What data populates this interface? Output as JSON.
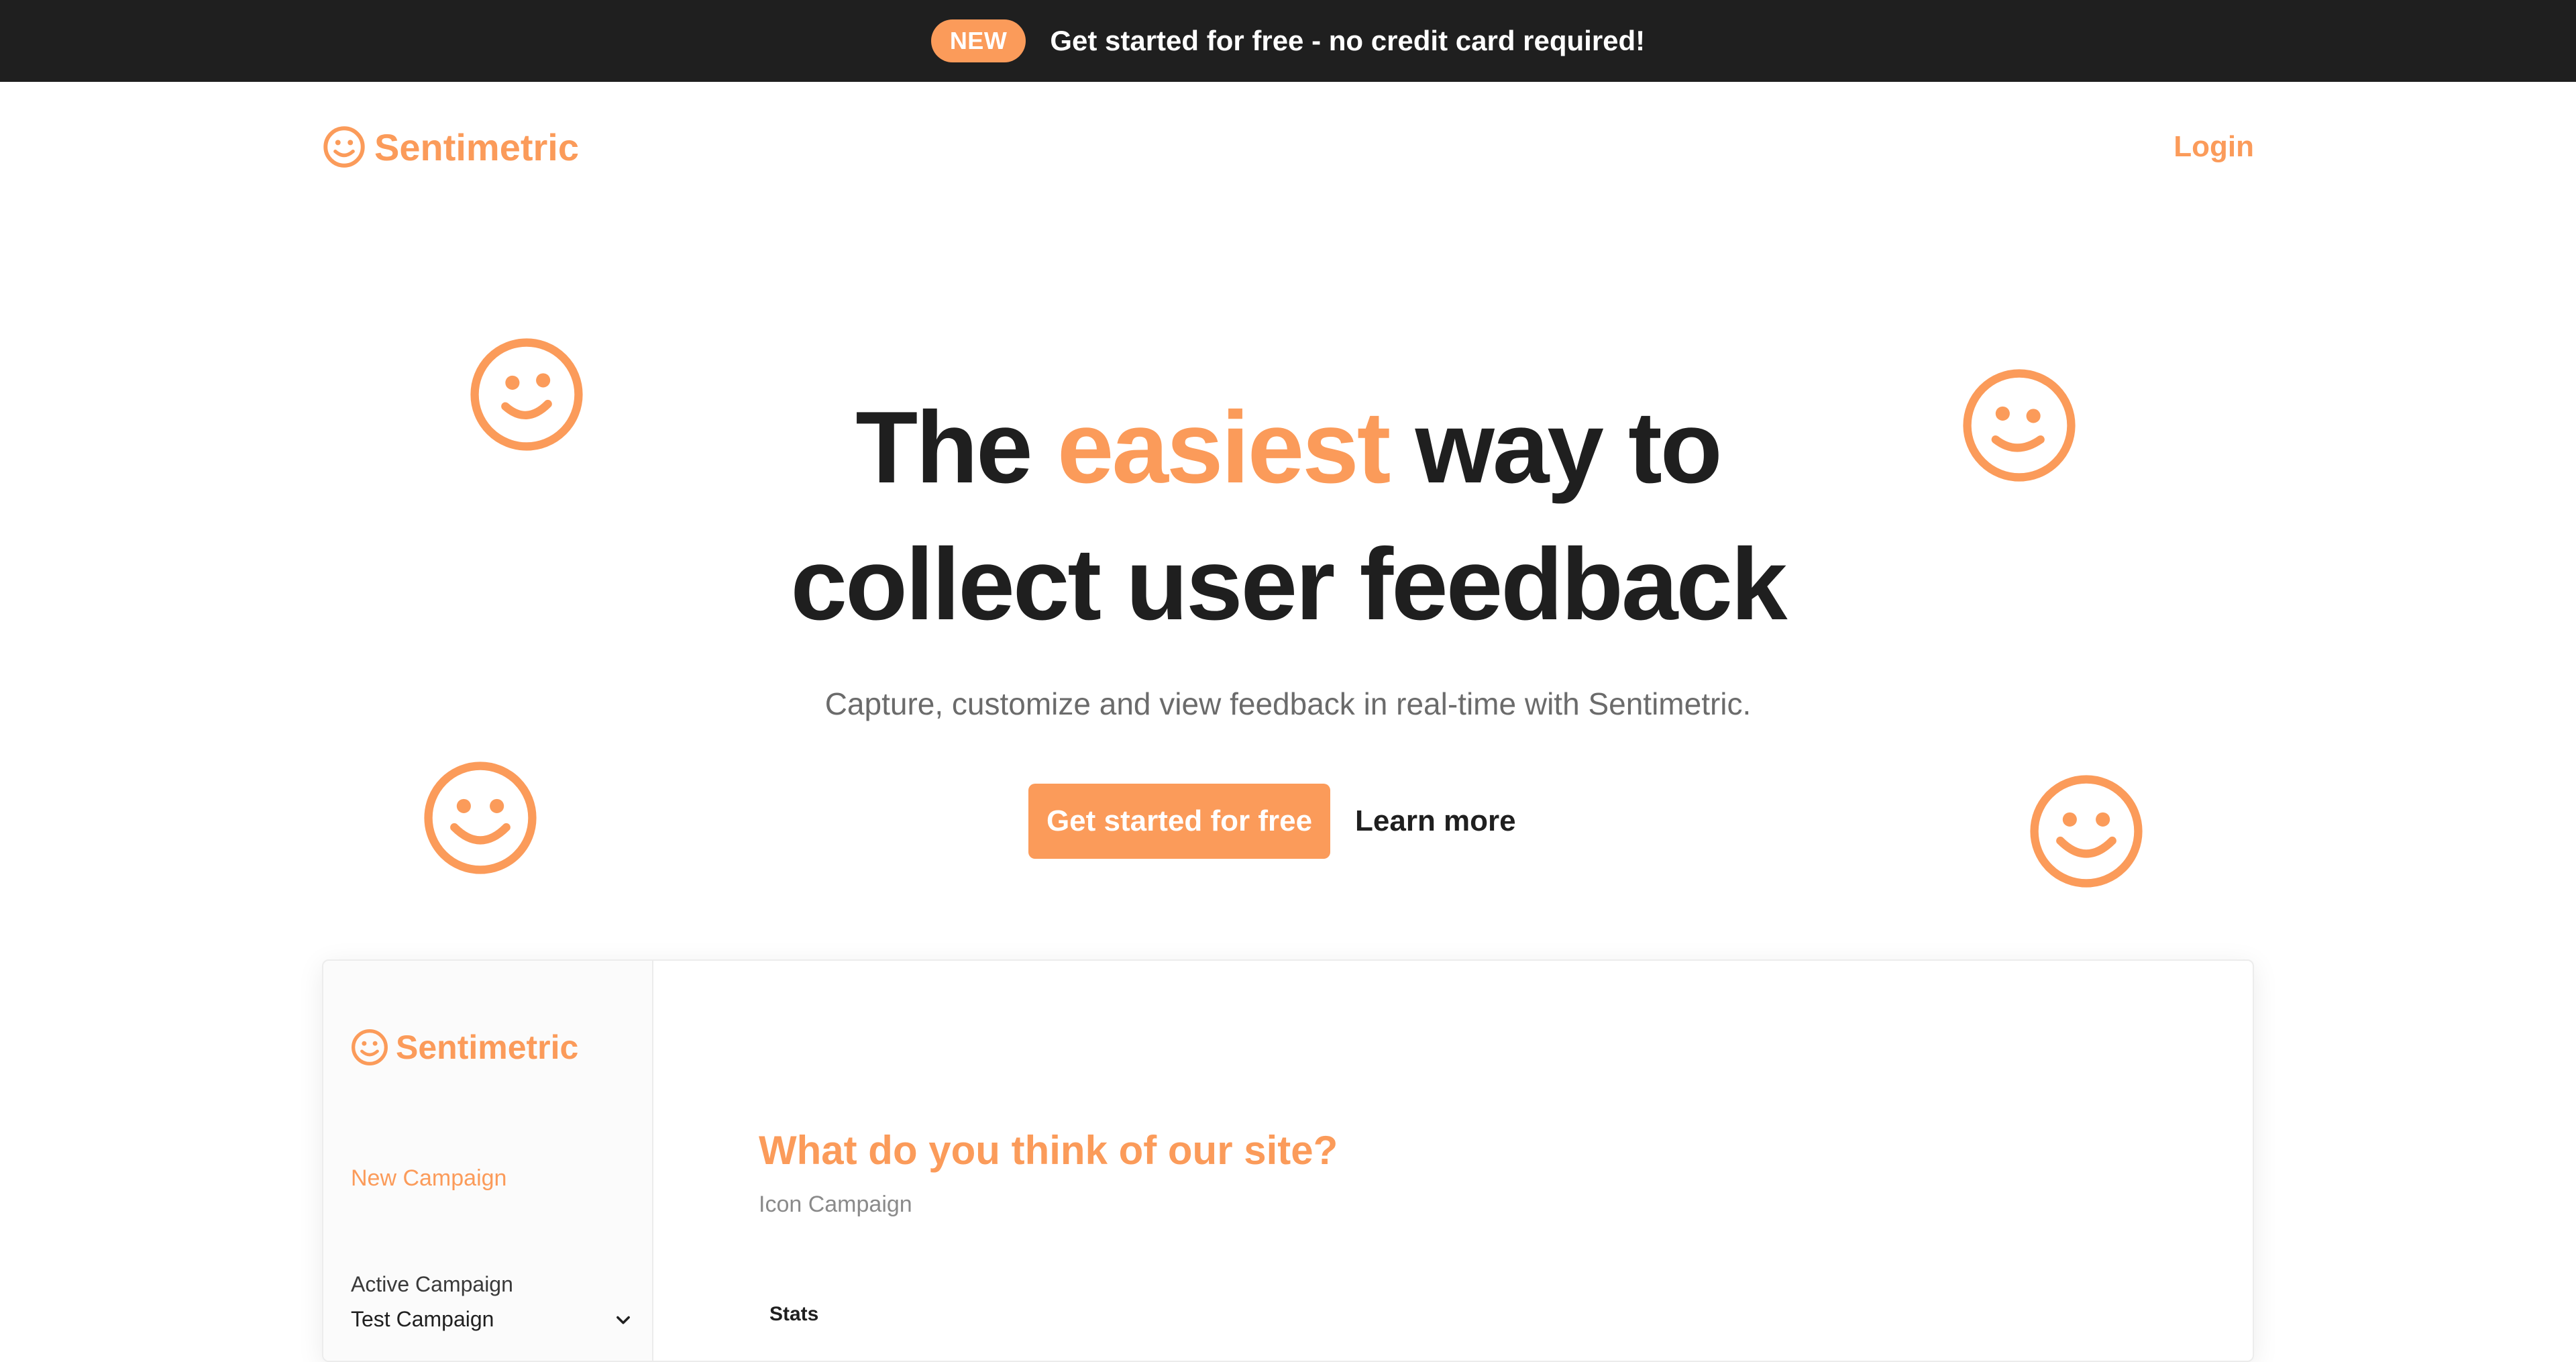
{
  "announcement": {
    "badge": "NEW",
    "message": "Get started for free - no credit card required!"
  },
  "nav": {
    "brand": "Sentimetric",
    "login": "Login"
  },
  "hero": {
    "title_before": "The ",
    "title_accent": "easiest",
    "title_after_line1": " way to",
    "title_line2": "collect user feedback",
    "subtitle": "Capture, customize and view feedback in real-time with Sentimetric.",
    "cta_primary": "Get started for free",
    "cta_secondary": "Learn more"
  },
  "preview": {
    "brand": "Sentimetric",
    "new_campaign": "New Campaign",
    "active_campaign_label": "Active Campaign",
    "active_campaign_value": "Test Campaign",
    "question": "What do you think of our site?",
    "campaign_type": "Icon Campaign",
    "stats_label": "Stats"
  },
  "colors": {
    "accent": "#fb9b5a",
    "dark": "#1f1f1f",
    "muted": "#6b6b6b"
  },
  "icons": [
    "smiley-icon",
    "chevron-down-icon"
  ]
}
